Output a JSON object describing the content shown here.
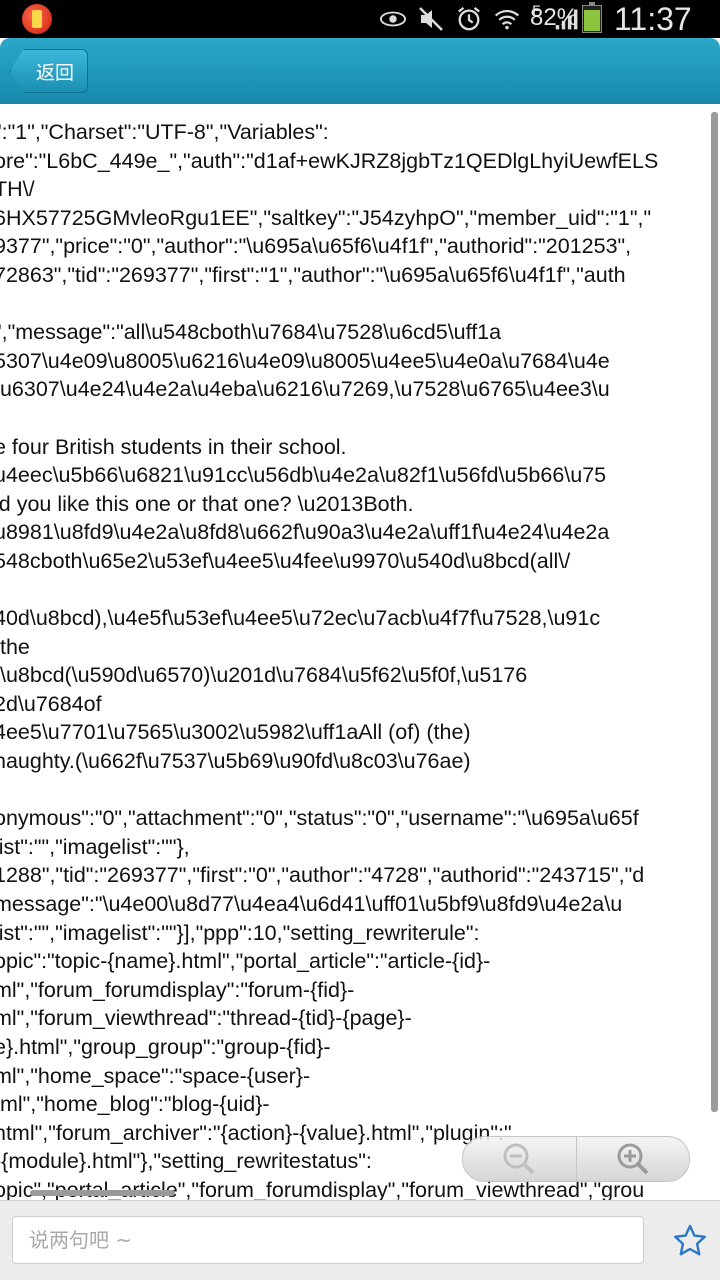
{
  "status_bar": {
    "battery_text": "82%",
    "battery_level": 0.82,
    "time": "11:37",
    "network_label": "E",
    "icons": [
      "app-notification-icon",
      "eye-icon",
      "mute-icon",
      "alarm-icon",
      "wifi-icon",
      "signal-icon",
      "battery-icon"
    ]
  },
  "header": {
    "back_label": "返回"
  },
  "content": {
    "raw_text": "\":\"1\",\"Charset\":\"UTF-8\",\"Variables\":\nore\":\"L6bC_449e_\",\"auth\":\"d1af+ewKJRZ8jgbTz1QEDlgLhyiUewfELS\nTH\\/\n6HX57725GMvleoRgu1EE\",\"saltkey\":\"J54zyhpO\",\"member_uid\":\"1\",\"\n9377\",\"price\":\"0\",\"author\":\"\\u695a\\u65f6\\u4f1f\",\"authorid\":\"201253\",\n72863\",\"tid\":\"269377\",\"first\":\"1\",\"author\":\"\\u695a\\u65f6\\u4f1f\",\"auth\n\n\",\"message\":\"all\\u548cboth\\u7684\\u7528\\u6cd5\\uff1a\n5307\\u4e09\\u8005\\u6216\\u4e09\\u8005\\u4ee5\\u4e0a\\u7684\\u4e\n\\u6307\\u4e24\\u4e2a\\u4eba\\u6216\\u7269,\\u7528\\u6765\\u4ee3\\u\n\ne four British students in their school.\nu4eec\\u5b66\\u6821\\u91cc\\u56db\\u4e2a\\u82f1\\u56fd\\u5b66\\u75\nld you like this one or that one? \\u2013Both.\nu8981\\u8fd9\\u4e2a\\u8fd8\\u662f\\u90a3\\u4e2a\\uff1f\\u4e24\\u4e2a\n548cboth\\u65e2\\u53ef\\u4ee5\\u4fee\\u9970\\u540d\\u8bcd(all\\/\n\n40d\\u8bcd),\\u4e5f\\u53ef\\u4ee5\\u72ec\\u7acb\\u4f7f\\u7528,\\u91c\n the\n,\\u8bcd(\\u590d\\u6570)\\u201d\\u7684\\u5f62\\u5f0f,\\u5176\n2d\\u7684of\n4ee5\\u7701\\u7565\\u3002\\u5982\\uff1aAll (of) (the)\nnaughty.(\\u662f\\u7537\\u5b69\\u90fd\\u8c03\\u76ae)\n\nonymous\":\"0\",\"attachment\":\"0\",\"status\":\"0\",\"username\":\"\\u695a\\u65f\nlist\":\"\",\"imagelist\":\"\"},\n1288\",\"tid\":\"269377\",\"first\":\"0\",\"author\":\"4728\",\"authorid\":\"243715\",\"d\nmessage\":\"\\u4e00\\u8d77\\u4ea4\\u6d41\\uff01\\u5bf9\\u8fd9\\u4e2a\\u\nlist\":\"\",\"imagelist\":\"\"}],\"ppp\":10,\"setting_rewriterule\":\nopic\":\"topic-{name}.html\",\"portal_article\":\"article-{id}-\nml\",\"forum_forumdisplay\":\"forum-{fid}-\nml\",\"forum_viewthread\":\"thread-{tid}-{page}-\ne}.html\",\"group_group\":\"group-{fid}-\nml\",\"home_space\":\"space-{user}-\ntml\",\"home_blog\":\"blog-{uid}-\nhtml\",\"forum_archiver\":\"{action}-{value}.html\",\"plugin\":\"\n-{module}.html\"},\"setting_rewritestatus\":\nopic\",\"portal_article\",\"forum_forumdisplay\",\"forum_viewthread\",\"grou"
  },
  "zoom": {
    "out_icon": "zoom-out-icon",
    "in_icon": "zoom-in-icon"
  },
  "bottom_bar": {
    "input_placeholder": "说两句吧 ~",
    "input_value": "",
    "favorite_icon": "star-icon",
    "accent_color": "#2a78c8"
  },
  "colors": {
    "header": "#1e97bb",
    "status_bar": "#000000",
    "battery": "#8cc63f"
  }
}
